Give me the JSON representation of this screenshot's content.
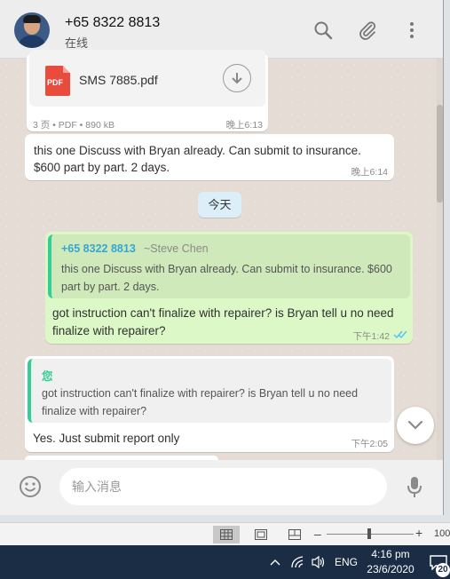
{
  "header": {
    "contact_name": "+65 8322 8813",
    "contact_status": "在线"
  },
  "messages": {
    "document": {
      "file_name": "SMS 7885.pdf",
      "file_badge": "PDF",
      "meta": "3 页 • PDF • 890 kB",
      "time": "晚上6:13"
    },
    "msg1": {
      "text": "this one Discuss with Bryan already. Can submit to insurance. $600 part by part. 2 days.",
      "time": "晚上6:14"
    },
    "date_divider": "今天",
    "msg2": {
      "quote_name": "+65 8322 8813",
      "quote_author": "~Steve Chen",
      "quote_text": "this one Discuss with Bryan already. Can submit to insurance. $600 part by part. 2 days.",
      "text": "got instruction can't finalize with repairer? is Bryan tell u no need finalize with repairer?",
      "time": "下午1:42"
    },
    "msg3": {
      "quote_name": "您",
      "quote_text": "got instruction can't finalize with repairer? is Bryan tell u no need finalize with repairer?",
      "text": "Yes. Just submit report only",
      "time": "下午2:05"
    }
  },
  "compose": {
    "placeholder": "输入消息"
  },
  "statusbar": {
    "zoom_percent": "100"
  },
  "taskbar": {
    "language": "ENG",
    "time": "4:16 pm",
    "date": "23/6/2020",
    "notification_count": "20"
  },
  "colors": {
    "outgoing_bubble": "#dcf8c6",
    "incoming_bubble": "#ffffff",
    "accent_green": "#35cd96",
    "read_ticks": "#4fc3f7"
  }
}
